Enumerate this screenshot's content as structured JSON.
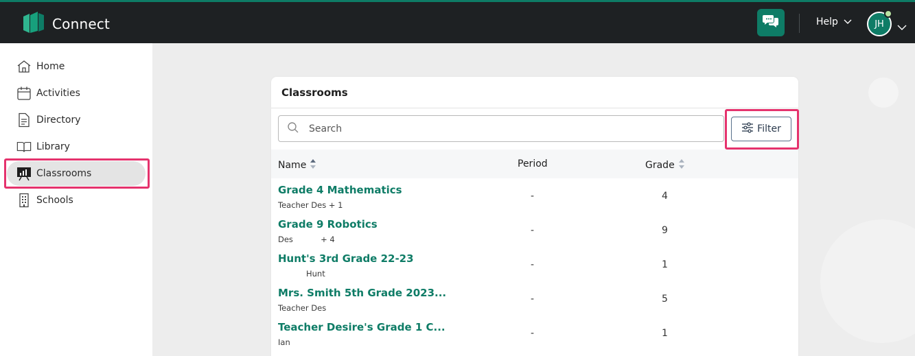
{
  "app": {
    "name": "Connect"
  },
  "header": {
    "help_label": "Help",
    "avatar_initials": "JH"
  },
  "sidebar": {
    "items": [
      {
        "label": "Home",
        "icon": "home-icon"
      },
      {
        "label": "Activities",
        "icon": "calendar-icon"
      },
      {
        "label": "Directory",
        "icon": "document-icon"
      },
      {
        "label": "Library",
        "icon": "book-icon"
      },
      {
        "label": "Classrooms",
        "icon": "classroom-icon",
        "active": true
      },
      {
        "label": "Schools",
        "icon": "building-icon"
      }
    ]
  },
  "main": {
    "card_title": "Classrooms",
    "search_placeholder": "Search",
    "filter_label": "Filter",
    "columns": {
      "name": "Name",
      "period": "Period",
      "grade": "Grade"
    },
    "rows": [
      {
        "name": "Grade 4 Mathematics",
        "sub": "Teacher Des + 1",
        "period": "-",
        "grade": "4"
      },
      {
        "name": "Grade 9 Robotics",
        "sub": "Des           + 4",
        "period": "-",
        "grade": "9"
      },
      {
        "name": "Hunt's 3rd Grade 22-23",
        "sub": "Hunt",
        "period": "-",
        "grade": "1"
      },
      {
        "name": "Mrs. Smith 5th Grade 2023...",
        "sub": "Teacher Des",
        "period": "-",
        "grade": "5"
      },
      {
        "name": "Teacher Desire's Grade 1 C...",
        "sub": "Ian",
        "period": "-",
        "grade": "1"
      }
    ]
  },
  "colors": {
    "brand": "#0e7c66",
    "topbar": "#1e2123",
    "highlight": "#e5326d"
  }
}
